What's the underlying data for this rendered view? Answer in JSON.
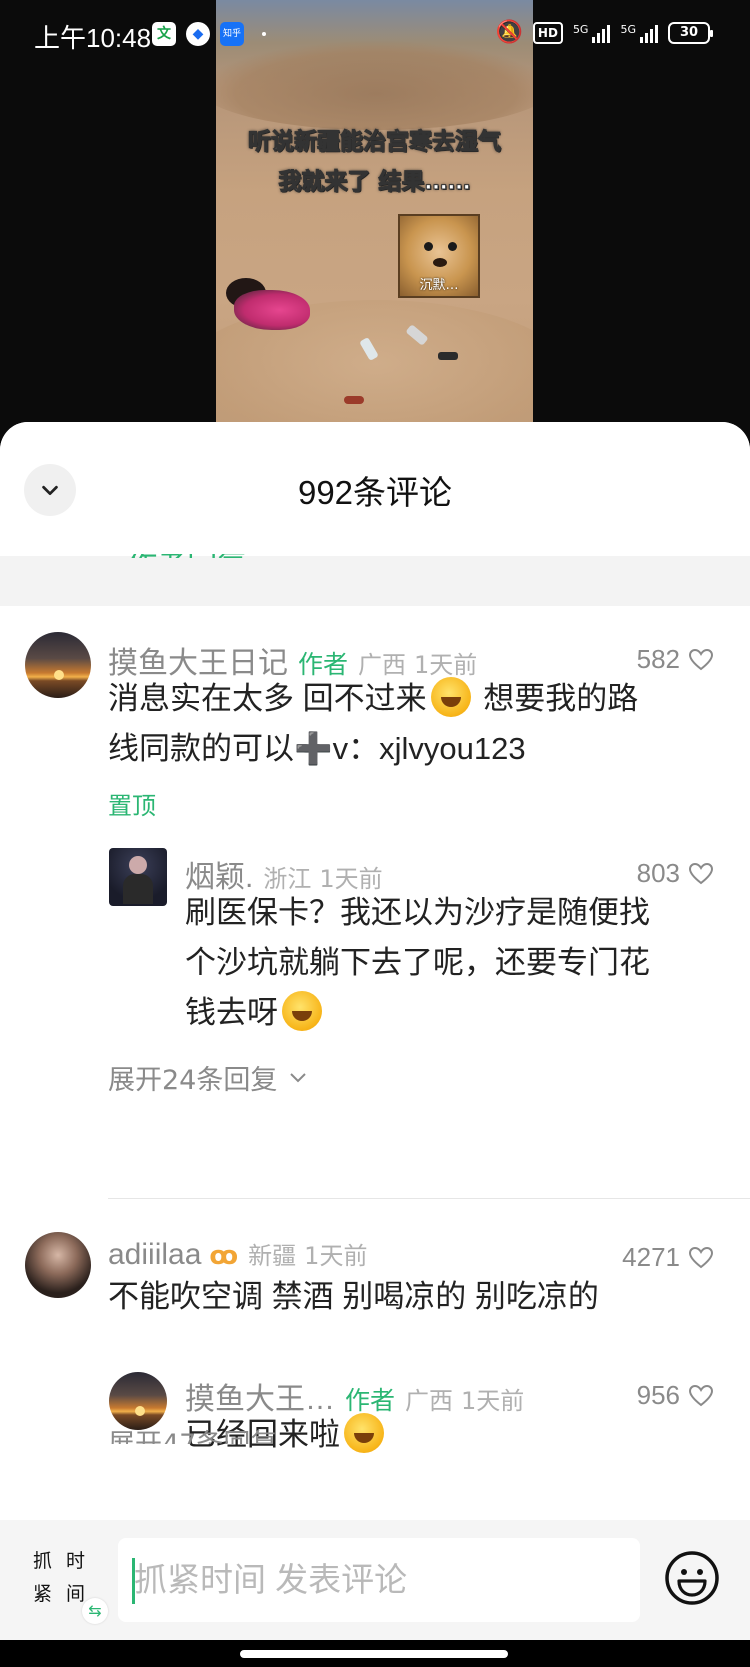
{
  "status_bar": {
    "time": "上午10:48",
    "badge_wen": "文",
    "badge_zhihu": "知乎",
    "hd_label": "HD",
    "net1": "5G",
    "net2": "5G",
    "battery": "30"
  },
  "video": {
    "caption_line1": "听说新疆能治宫寒去湿气",
    "caption_line2": "我就来了 结果……",
    "sticker_text": "沉默…"
  },
  "sheet": {
    "title": "992条评论",
    "peek_top_text": "• 作者回复"
  },
  "comments": [
    {
      "name": "摸鱼大王日记",
      "author_tag": "作者",
      "location": "广西",
      "time": "1天前",
      "likes": "582",
      "text_line1_a": "消息实在太多  回不过来",
      "text_line1_b": " 想要我的路",
      "text_line2_a": "线同款的可以",
      "plus": "➕",
      "text_line2_b": "v：xjlvyou123",
      "pin_label": "置顶"
    },
    {
      "name": "烟颖.",
      "location": "浙江",
      "time": "1天前",
      "likes": "803",
      "text_line1": "刷医保卡？我还以为沙疗是随便找",
      "text_line2": "个沙坑就躺下去了呢，还要专门花",
      "text_line3": "钱去呀",
      "expand_label": "展开24条回复"
    },
    {
      "name": "adiiilaa",
      "vip_icon": "ꝏ",
      "location": "新疆",
      "time": "1天前",
      "likes": "4271",
      "text": "不能吹空调 禁酒 别喝凉的 别吃凉的"
    },
    {
      "name": "摸鱼大王…",
      "author_tag": "作者",
      "location": "广西",
      "time": "1天前",
      "likes": "956",
      "text": "已经回来啦"
    }
  ],
  "peek_bottom_text": "展开47条回复",
  "input_bar": {
    "logo_chars": [
      "抓",
      "时",
      "紧",
      "间"
    ],
    "swap_icon": "⇆",
    "placeholder": "抓紧时间 发表评论"
  },
  "icons": {
    "collapse": "chevron-down-icon",
    "like": "heart-outline-icon",
    "emoji": "smiley-face-icon"
  },
  "colors": {
    "accent_green": "#2bb673",
    "meta_gray": "#8a8a8a"
  }
}
